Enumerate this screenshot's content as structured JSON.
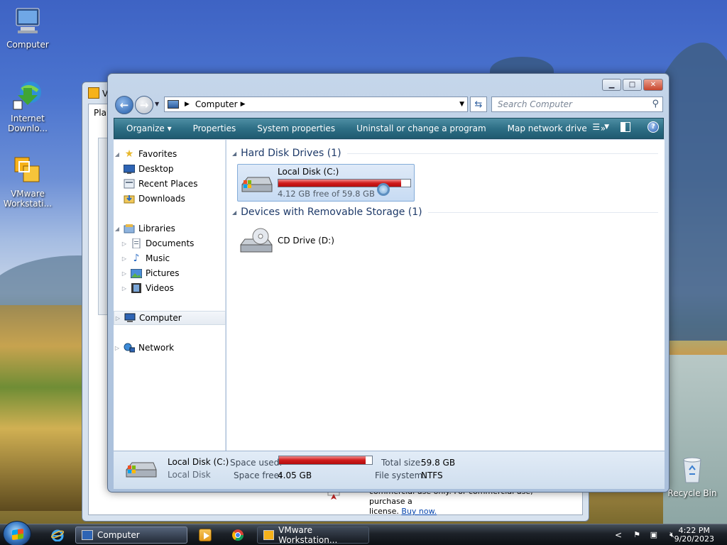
{
  "desktop": {
    "icons": [
      {
        "label": "Computer"
      },
      {
        "label": "Internet Downlo..."
      },
      {
        "label": "VMware Workstati..."
      },
      {
        "label": "Recycle Bin"
      }
    ]
  },
  "background_window": {
    "title_initial": "V",
    "tab_text": "Pla",
    "footer_line1": "commercial use only. For commercial use, purchase a",
    "footer_line2": "license.",
    "footer_link": "Buy now."
  },
  "window": {
    "address": {
      "location": "Computer"
    },
    "search": {
      "placeholder": "Search Computer"
    },
    "toolbar": {
      "organize": "Organize",
      "properties": "Properties",
      "system_properties": "System properties",
      "uninstall": "Uninstall or change a program",
      "map_drive": "Map network drive",
      "more": "»"
    },
    "nav": {
      "favorites": "Favorites",
      "desktop": "Desktop",
      "recent": "Recent Places",
      "downloads": "Downloads",
      "libraries": "Libraries",
      "documents": "Documents",
      "music": "Music",
      "pictures": "Pictures",
      "videos": "Videos",
      "computer": "Computer",
      "network": "Network"
    },
    "content": {
      "hdd_header": "Hard Disk Drives (1)",
      "removable_header": "Devices with Removable Storage (1)",
      "local_disk_name": "Local Disk (C:)",
      "local_disk_free": "4.12 GB free of 59.8 GB",
      "local_disk_used_fraction": 0.93,
      "cd_name": "CD Drive (D:)"
    },
    "details": {
      "name": "Local Disk (C:)",
      "type": "Local Disk",
      "space_used_label": "Space used:",
      "space_free_label": "Space free:",
      "space_free": "4.05 GB",
      "total_size_label": "Total size:",
      "total_size": "59.8 GB",
      "fs_label": "File system:",
      "fs": "NTFS",
      "used_fraction": 0.93
    }
  },
  "taskbar": {
    "task_computer": "Computer",
    "task_vmware": "VMware Workstation...",
    "time": "4:22 PM",
    "date": "9/20/2023",
    "tray_chevron": "<"
  }
}
